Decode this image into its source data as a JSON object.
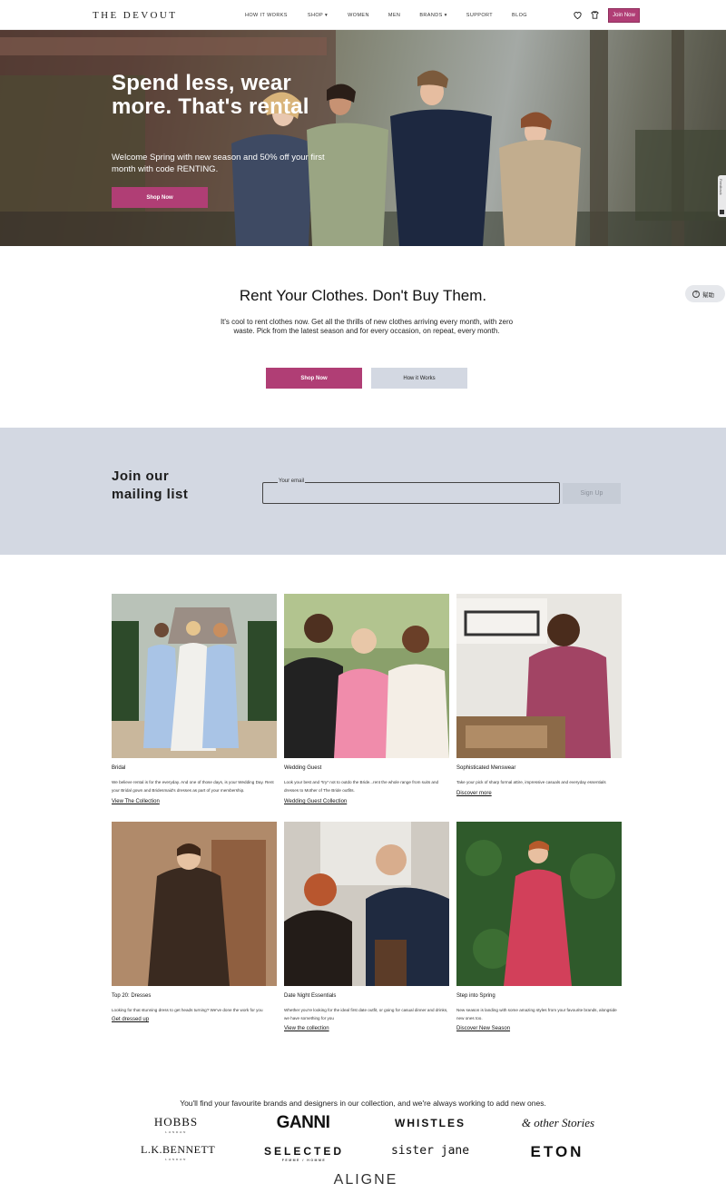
{
  "nav": {
    "logo": "THE DEVOUT",
    "links": [
      "HOW IT WORKS",
      "SHOP",
      "WOMEN",
      "MEN",
      "BRANDS",
      "SUPPORT",
      "BLOG"
    ],
    "join_label": "Join Now"
  },
  "hero": {
    "title": "Spend less, wear more. That's rental",
    "subtitle": "Welcome Spring with new season and 50% off your first month with code RENTING.",
    "button": "Shop Now",
    "feedback": "Feedback"
  },
  "rent": {
    "title": "Rent Your Clothes. Don't Buy Them.",
    "body": "It's cool to rent clothes now. Get all the thrills of new clothes arriving every month, with zero waste. Pick from the latest season and for every occasion, on repeat, every month.",
    "shop_button": "Shop Now",
    "how_button": "How it Works",
    "help_label": "幫助"
  },
  "mailing": {
    "title": "Join our mailing list",
    "field_label": "Your email",
    "signup_label": "Sign Up"
  },
  "collections": [
    {
      "title": "Bridal",
      "desc": "We believe rental is for the everyday. And one of those days, is your Wedding Day. Rent your Bridal gown and Bridesmaid's dresses as part of your membership.",
      "link": "View The Collection"
    },
    {
      "title": "Wedding Guest",
      "desc": "Look your best and *try* not to outdo the Bride...rent the whole range from suits and dresses to Mother of The Bride outfits.",
      "link": "Wedding Guest Collection"
    },
    {
      "title": "Sophisticated Menswear",
      "desc": "Take your pick of sharp formal attire, impressive casuals and everyday essentials",
      "link": "Discover more"
    },
    {
      "title": "Top 20: Dresses",
      "desc": "Looking for that stunning dress to get heads turning? We've done the work for you",
      "link": "Get dressed up"
    },
    {
      "title": "Date Night Essentials",
      "desc": "Whether you're looking for the ideal first date outfit, or going for casual dinner and drinks, we have something for you",
      "link": "View the collection"
    },
    {
      "title": "Step into Spring",
      "desc": "New season is landing with some amazing styles from your favourite brands, alongside new ones too.",
      "link": "Discover New Season"
    }
  ],
  "brands": {
    "intro": "You'll find your favourite brands and designers in our collection, and we're always working to add new ones.",
    "hobbs": "HOBBS",
    "hobbs_sub": "LONDON",
    "ganni": "GANNI",
    "whistles": "WHISTLES",
    "other_stories": "& other Stories",
    "lk_bennett": "L.K.BENNETT",
    "lk_sub": "LONDON",
    "selected": "SELECTED",
    "selected_sub": "FEMME / HOMME",
    "sister_jane": "sister jane",
    "eton": "ETON",
    "aligne": "ALIGNE"
  },
  "colors": {
    "accent": "#b03e75",
    "mailing_bg": "#d3d8e2"
  }
}
